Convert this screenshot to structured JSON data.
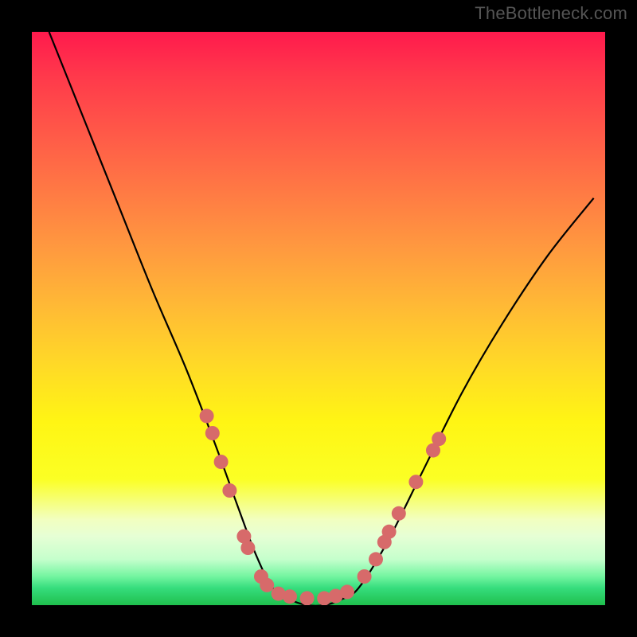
{
  "watermark": "TheBottleneck.com",
  "chart_data": {
    "type": "line",
    "title": "",
    "xlabel": "",
    "ylabel": "",
    "xlim": [
      0,
      100
    ],
    "ylim": [
      0,
      100
    ],
    "grid": false,
    "curve_points": [
      [
        3,
        100
      ],
      [
        9,
        85
      ],
      [
        15,
        70
      ],
      [
        21,
        55
      ],
      [
        27,
        41
      ],
      [
        32,
        28
      ],
      [
        36,
        17
      ],
      [
        39,
        9
      ],
      [
        42,
        3
      ],
      [
        45,
        1
      ],
      [
        48,
        0
      ],
      [
        51,
        0
      ],
      [
        54,
        1
      ],
      [
        57,
        3
      ],
      [
        62,
        11
      ],
      [
        68,
        23
      ],
      [
        75,
        37
      ],
      [
        82,
        49
      ],
      [
        90,
        61
      ],
      [
        98,
        71
      ]
    ],
    "marker_points": [
      [
        30.5,
        33
      ],
      [
        31.5,
        30
      ],
      [
        33,
        25
      ],
      [
        34.5,
        20
      ],
      [
        37,
        12
      ],
      [
        37.7,
        10
      ],
      [
        40,
        5
      ],
      [
        41,
        3.5
      ],
      [
        43,
        2
      ],
      [
        45,
        1.5
      ],
      [
        48,
        1.2
      ],
      [
        51,
        1.2
      ],
      [
        53,
        1.6
      ],
      [
        55,
        2.3
      ],
      [
        58,
        5
      ],
      [
        60,
        8
      ],
      [
        61.5,
        11
      ],
      [
        62.3,
        12.8
      ],
      [
        64,
        16
      ],
      [
        67,
        21.5
      ],
      [
        70,
        27
      ],
      [
        71,
        29
      ]
    ],
    "colors": {
      "curve": "#000000",
      "markers": "#d76a6a",
      "gradient_top": "#ff1a4d",
      "gradient_mid": "#ffd927",
      "gradient_bottom": "#1fbf4d"
    }
  }
}
